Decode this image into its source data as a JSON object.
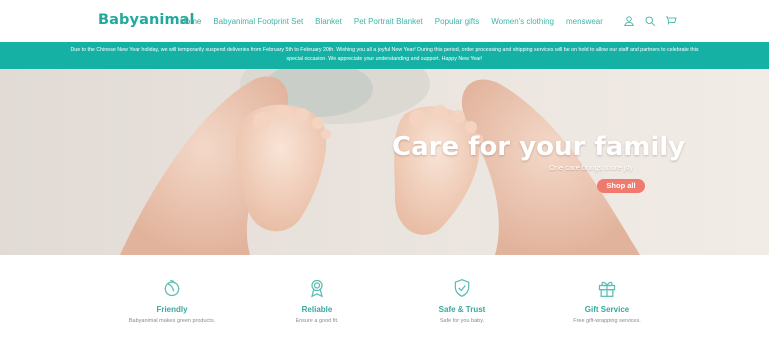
{
  "header": {
    "logo": "Babyanimal",
    "nav": [
      {
        "label": "Home"
      },
      {
        "label": "Babyanimal Footprint Set"
      },
      {
        "label": "Blanket"
      },
      {
        "label": "Pet Portrait Blanket"
      },
      {
        "label": "Popular gifts"
      },
      {
        "label": "Women's clothing"
      },
      {
        "label": "menswear"
      }
    ],
    "icons": [
      "account-icon",
      "search-icon",
      "cart-icon"
    ]
  },
  "announcement": {
    "text": "Due to the Chinese New Year holiday, we will temporarily suspend deliveries from February 5th to February 20th. Wishing you all a joyful New Year! During this period, order processing and shipping services will be on hold to allow our staff and partners to celebrate this special occasion. We appreciate your understanding and support. Happy New Year!"
  },
  "hero": {
    "title": "Care for your family",
    "subtitle": "One care brings more joy",
    "button_label": "Shop all"
  },
  "features": [
    {
      "icon": "leaf-icon",
      "title": "Friendly",
      "desc": "Babyanimal makes green products."
    },
    {
      "icon": "award-ribbon-icon",
      "title": "Reliable",
      "desc": "Ensure a good fit."
    },
    {
      "icon": "shield-check-icon",
      "title": "Safe & Trust",
      "desc": "Safe for you baby."
    },
    {
      "icon": "gift-icon",
      "title": "Gift Service",
      "desc": "Free gift-wrapping services."
    }
  ],
  "colors": {
    "brand": "#20a99c",
    "announcement_bg": "#16b1a5",
    "button": "#f07a6e"
  }
}
